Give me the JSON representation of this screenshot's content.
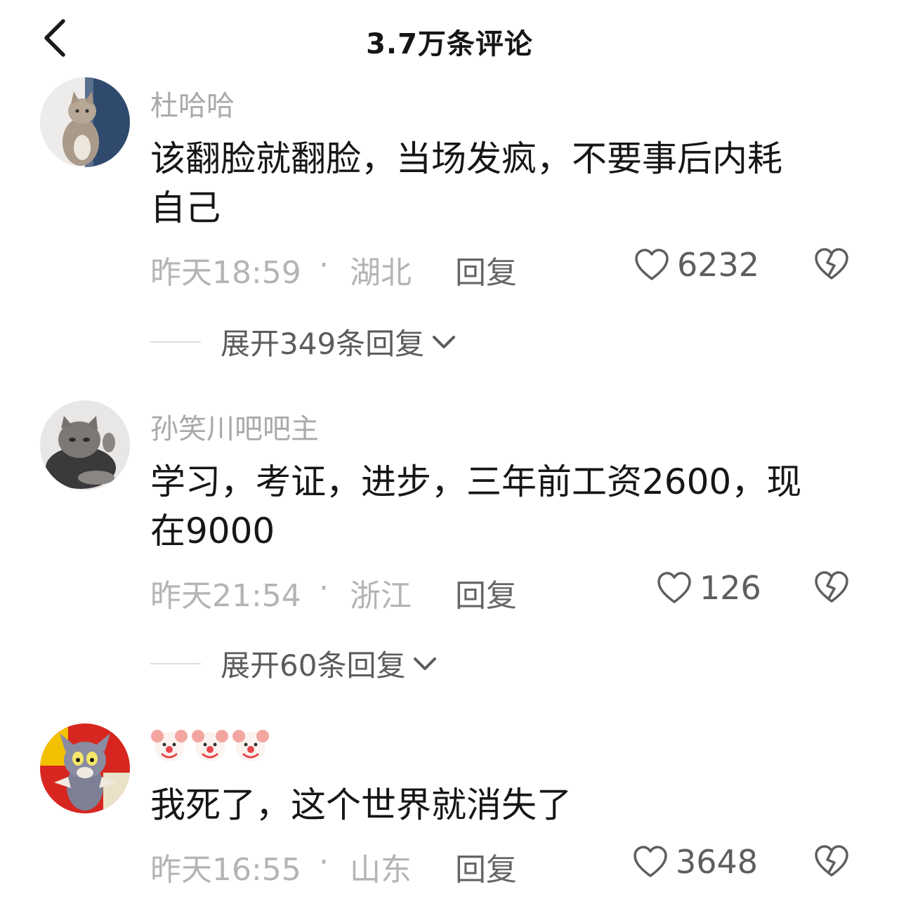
{
  "header": {
    "title": "3.7万条评论"
  },
  "comments": [
    {
      "username": "杜哈哈",
      "content_line1": "该翻脸就翻脸，当场发疯，不要事后内耗",
      "content_line2": "自己",
      "time": "昨天18:59",
      "separator": "·",
      "location": "湖北",
      "reply_label": "回复",
      "likes": "6232",
      "expand_label": "展开349条回复"
    },
    {
      "username": "孙笑川吧吧主",
      "content_line1": "学习，考证，进步，三年前工资2600，现",
      "content_line2": "在9000",
      "time": "昨天21:54",
      "separator": "·",
      "location": "浙江",
      "reply_label": "回复",
      "likes": "126",
      "expand_label": "展开60条回复"
    },
    {
      "username_emoji": [
        "clown-face",
        "clown-face",
        "clown-face"
      ],
      "content_line1": "我死了，这个世界就消失了",
      "time": "昨天16:55",
      "separator": "·",
      "location": "山东",
      "reply_label": "回复",
      "likes": "3648"
    }
  ],
  "icons": {
    "back": "chevron-left-icon",
    "like": "heart-outline-icon",
    "dislike": "broken-heart-icon",
    "expand": "chevron-down-icon"
  },
  "colors": {
    "text_primary": "#161616",
    "text_secondary": "#b4b4b4",
    "username": "#a9a9a9",
    "like_count": "#5e5e5e"
  }
}
